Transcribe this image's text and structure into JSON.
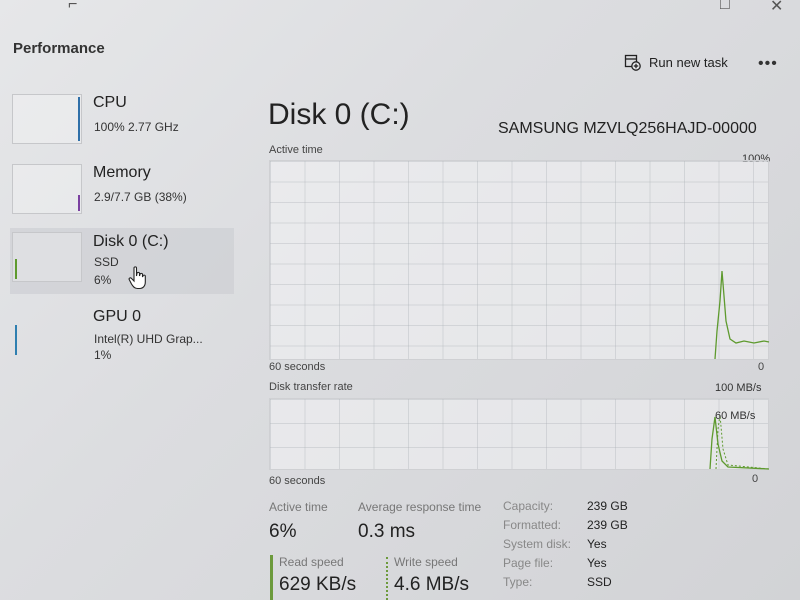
{
  "header": {
    "title": "Performance",
    "run_task_label": "Run new task",
    "more_label": "•••"
  },
  "sidebar": {
    "items": [
      {
        "name": "CPU",
        "sub1": "100% 2.77 GHz",
        "sub2": ""
      },
      {
        "name": "Memory",
        "sub1": "2.9/7.7 GB (38%)",
        "sub2": ""
      },
      {
        "name": "Disk 0 (C:)",
        "sub1": "SSD",
        "sub2": "6%"
      },
      {
        "name": "GPU 0",
        "sub1": "Intel(R) UHD Grap...",
        "sub2": "1%"
      }
    ]
  },
  "main": {
    "title": "Disk 0 (C:)",
    "model": "SAMSUNG MZVLQ256HAJD-00000",
    "active_time_graph": {
      "label": "Active time",
      "max": "100%",
      "min": "0",
      "time_label": "60 seconds"
    },
    "transfer_graph": {
      "label": "Disk transfer rate",
      "max": "100 MB/s",
      "mid": "60 MB/s",
      "min": "0",
      "time_label": "60 seconds"
    },
    "stats": {
      "active_time_label": "Active time",
      "active_time_value": "6%",
      "avg_response_label": "Average response time",
      "avg_response_value": "0.3 ms",
      "read_speed_label": "Read speed",
      "read_speed_value": "629 KB/s",
      "write_speed_label": "Write speed",
      "write_speed_value": "4.6 MB/s"
    },
    "details": [
      {
        "key": "Capacity:",
        "value": "239 GB"
      },
      {
        "key": "Formatted:",
        "value": "239 GB"
      },
      {
        "key": "System disk:",
        "value": "Yes"
      },
      {
        "key": "Page file:",
        "value": "Yes"
      },
      {
        "key": "Type:",
        "value": "SSD"
      }
    ]
  },
  "colors": {
    "disk_accent": "#5e9a2e",
    "cpu_accent": "#2f6fa8",
    "memory_accent": "#7a3fa0",
    "gpu_accent": "#2f7fb0"
  },
  "icons": {
    "run_task": "run-task-icon",
    "more": "more-options-icon",
    "cursor": "hand-cursor-icon"
  }
}
